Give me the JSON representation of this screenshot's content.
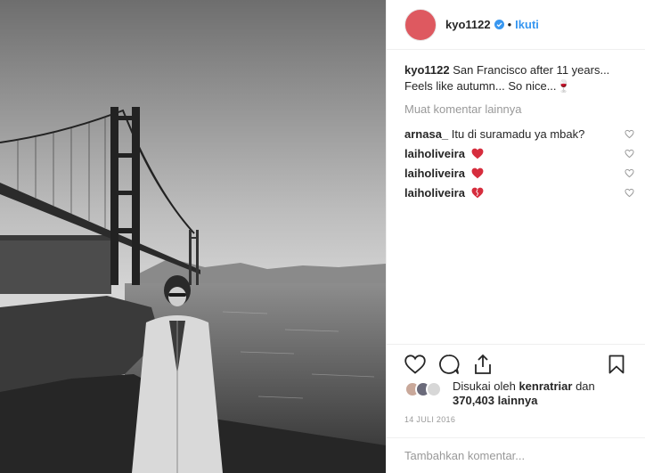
{
  "post": {
    "username": "kyo1122",
    "separator": "•",
    "follow_label": "Ikuti",
    "caption_text": "San Francisco after 11 years... Feels like autumn... So nice...🍷",
    "load_more_label": "Muat komentar lainnya",
    "comments": [
      {
        "user": "arnasa_",
        "text": "Itu di suramadu ya mbak?"
      },
      {
        "user": "laiholiveira",
        "text": ""
      },
      {
        "user": "laiholiveira",
        "text": ""
      },
      {
        "user": "laiholiveira",
        "text": ""
      }
    ],
    "likes_prefix": "Disukai oleh",
    "likes_user": "kenratriar",
    "likes_and": "dan",
    "likes_count": "370,403",
    "likes_suffix": "lainnya",
    "date": "14 JULI 2016",
    "add_comment_placeholder": "Tambahkan komentar..."
  },
  "icons": {
    "verified": "verified-badge-icon",
    "like": "heart-icon",
    "comment": "comment-icon",
    "share": "share-icon",
    "save": "bookmark-icon",
    "comment_heart": "heart-icon",
    "emoji_heart": "red-heart-emoji"
  },
  "colors": {
    "accent": "#3897f0",
    "avatar": "#de5960",
    "heart_emoji": "#d62d3d",
    "muted": "#999999"
  }
}
